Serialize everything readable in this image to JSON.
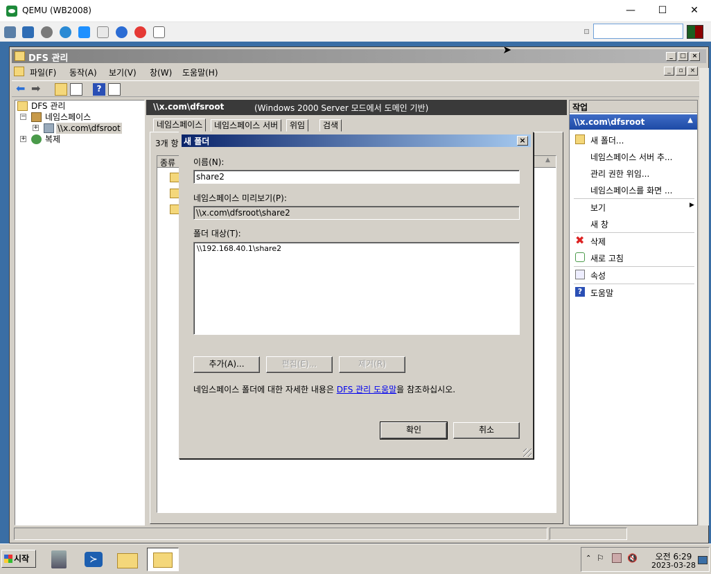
{
  "host": {
    "title": "QEMU (WB2008)",
    "controls": {
      "minimize": "—",
      "maximize": "☐",
      "close": "✕"
    }
  },
  "mmc": {
    "title": "DFS 관리",
    "menu": [
      "파일(F)",
      "동작(A)",
      "보기(V)",
      "창(W)",
      "도움말(H)"
    ],
    "tree": {
      "root": "DFS 관리",
      "namespaces": "네임스페이스",
      "namespace_item": "\\\\x.com\\dfsroot",
      "replication": "복제"
    },
    "center": {
      "header_path": "\\\\x.com\\dfsroot",
      "header_mode": "(Windows 2000 Server 모드에서 도메인 기반)",
      "tabs": [
        "네임스페이스",
        "네임스페이스 서버",
        "위임",
        "검색"
      ],
      "count_text": "3개 항",
      "col_type": "종류"
    },
    "actions": {
      "header": "작업",
      "section": "\\\\x.com\\dfsroot",
      "items": [
        "새 폴더...",
        "네임스페이스 서버 추...",
        "관리 권한 위임...",
        "네임스페이스를 화면 ...",
        "보기",
        "새 창",
        "삭제",
        "새로 고침",
        "속성",
        "도움말"
      ]
    }
  },
  "dialog": {
    "title": "새 폴더",
    "name_label": "이름(N):",
    "name_value": "share2",
    "preview_label": "네임스페이스 미리보기(P):",
    "preview_value": "\\\\x.com\\dfsroot\\share2",
    "targets_label": "폴더 대상(T):",
    "targets": [
      "\\\\192.168.40.1\\share2"
    ],
    "add_button": "추가(A)...",
    "edit_button": "편집(E)...",
    "remove_button": "제거(R)",
    "help_prefix": "네임스페이스 폴더에 대한 자세한 내용은 ",
    "help_link": "DFS 관리 도움말",
    "help_suffix": "을 참조하십시오.",
    "ok_button": "확인",
    "cancel_button": "취소"
  },
  "taskbar": {
    "start": "시작",
    "time": "오전 6:29",
    "date": "2023-03-28"
  },
  "colors": {
    "dialog_title_start": "#0a246a",
    "dialog_title_end": "#a6caf0",
    "action_section": "#1d4aa6",
    "desktop": "#3a6ea5"
  }
}
